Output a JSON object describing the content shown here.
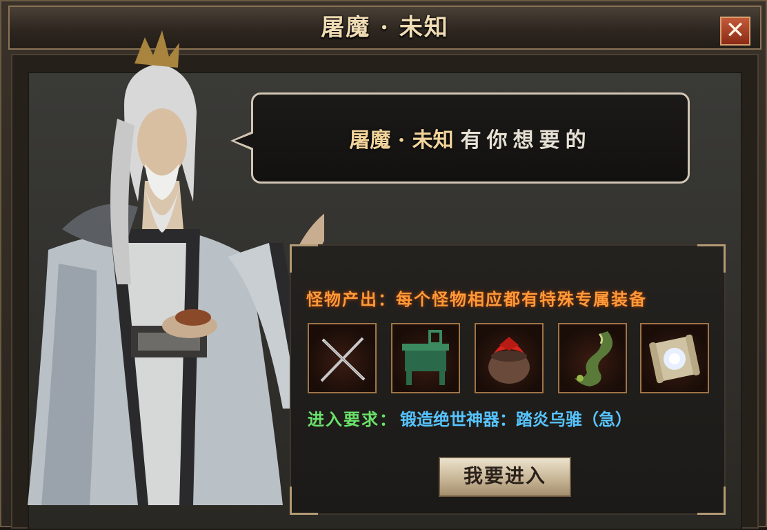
{
  "window": {
    "title": "屠魔 · 未知",
    "close_label": "✕"
  },
  "dialog": {
    "speaker_highlight": "屠魔 · 未知",
    "speech_rest": "有你想要的"
  },
  "drops": {
    "label": "怪物产出：每个怪物相应都有特殊专属装备",
    "items": [
      {
        "icon": "crossed-blades-icon"
      },
      {
        "icon": "jade-cauldron-icon"
      },
      {
        "icon": "treasure-pot-icon"
      },
      {
        "icon": "green-dragon-icon"
      },
      {
        "icon": "glowing-scroll-icon"
      }
    ]
  },
  "requirement": {
    "label": "进入要求：",
    "value": "锻造绝世神器：踏炎乌骓（急）"
  },
  "actions": {
    "enter_label": "我要进入"
  },
  "colors": {
    "drops_label": "#ff9a3a",
    "requirement_label": "#6be16b",
    "requirement_value": "#57c4ff",
    "title": "#f0dcb4"
  }
}
